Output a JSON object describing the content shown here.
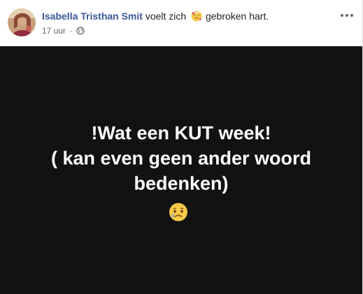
{
  "post": {
    "author": "Isabella Tristhan Smit",
    "feeling_prefix": "voelt zich",
    "feeling_emoji": "face-with-bandage-and-hearts-icon",
    "feeling_label": "gebroken hart.",
    "timestamp": "17 uur",
    "separator": "·",
    "privacy_icon": "globe-icon",
    "more_icon": "more-options-icon"
  },
  "status": {
    "lines": [
      "!Wat een KUT week!",
      "( kan even geen ander woord",
      "bedenken)"
    ],
    "emoji": "crying-face-icon",
    "background_color": "#121212",
    "text_color": "#ffffff"
  },
  "colors": {
    "author_link": "#385898",
    "secondary_text": "#616770"
  }
}
